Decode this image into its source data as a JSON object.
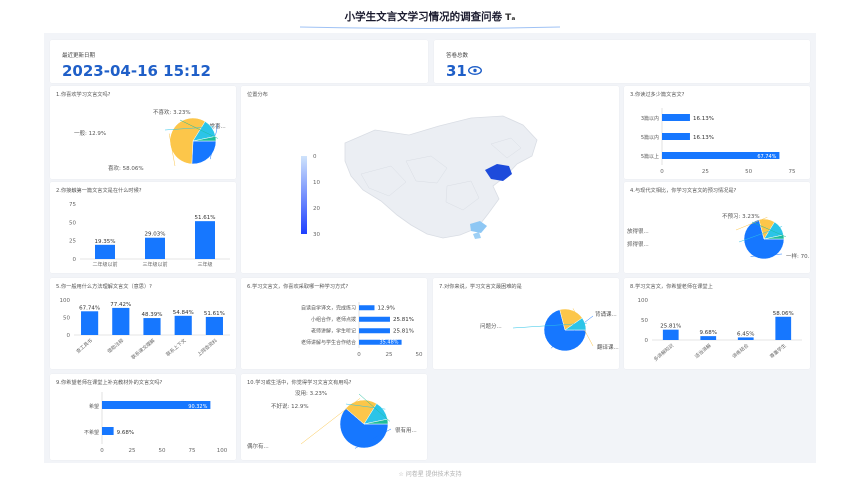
{
  "page": {
    "title": "小学生文言文学习情况的调查问卷",
    "title_icon": "Tₐ",
    "footer_icon": "☆",
    "footer": "问卷星 提供技术支持"
  },
  "stats": {
    "update_label": "最近更新日期",
    "update_value": "2023-04-16 15:12",
    "count_label": "答卷总数",
    "count_value": "31",
    "count_icon": "eye-icon"
  },
  "colors": {
    "blue": "#1677ff",
    "light_blue": "#2bc4e8",
    "yellow": "#fcc64a",
    "teal": "#1ebd9a",
    "accent": "#1f5fc8"
  },
  "chart_data": [
    {
      "id": "q1",
      "type": "pie",
      "title": "1.你喜欢学习文言文吗?",
      "labels": [
        "非常喜欢",
        "喜欢",
        "一般",
        "不喜欢"
      ],
      "display_labels": [
        "非常喜...",
        "喜欢: 58.06%",
        "一般: 12.9%",
        "不喜欢: 3.23%"
      ],
      "values": [
        25.81,
        58.06,
        12.9,
        3.23
      ],
      "colors": [
        "#1677ff",
        "#fcc64a",
        "#2bc4e8",
        "#1ebd9a"
      ]
    },
    {
      "id": "q2",
      "type": "bar",
      "title": "2.你接触第一篇文言文是在什么时候?",
      "categories": [
        "二年级以前",
        "三年级以前",
        "三年级"
      ],
      "values": [
        19.35,
        29.03,
        51.61
      ],
      "value_labels": [
        "19.35%",
        "29.03%",
        "51.61%"
      ],
      "ylim": [
        0,
        75
      ],
      "yticks": [
        0,
        25,
        50,
        75
      ]
    },
    {
      "id": "q3",
      "type": "bar",
      "orientation": "horizontal",
      "title": "3.你读过多少篇文言文?",
      "categories": [
        "3篇以内",
        "5篇以内",
        "5篇以上"
      ],
      "values": [
        16.13,
        16.13,
        67.74
      ],
      "value_labels": [
        "16.13%",
        "16.13%",
        "67.74%"
      ],
      "xlim": [
        0,
        75
      ],
      "xticks": [
        0,
        25,
        50,
        75
      ]
    },
    {
      "id": "q4",
      "type": "pie",
      "title": "4.与现代文相比，你学习文言文的预习情况是?",
      "labels": [
        "一样",
        "放得很...",
        "抓得很...",
        "不预习"
      ],
      "display_labels": [
        "一样: 70...",
        "放得很...",
        "抓得很...",
        "不预习: 3.23%"
      ],
      "values": [
        70.97,
        12.9,
        12.9,
        3.23
      ],
      "colors": [
        "#1677ff",
        "#fcc64a",
        "#2bc4e8",
        "#1ebd9a"
      ]
    },
    {
      "id": "q5",
      "type": "bar",
      "title": "5.你一般用什么方法理解文言文（意思）?",
      "categories": [
        "查工具书",
        "借助注释",
        "联系课文理解",
        "联系上下文",
        "上网查资料"
      ],
      "values": [
        67.74,
        77.42,
        48.39,
        54.84,
        51.61
      ],
      "value_labels": [
        "67.74%",
        "77.42%",
        "48.39%",
        "54.84%",
        "51.61%"
      ],
      "ylim": [
        0,
        100
      ],
      "yticks": [
        0,
        50,
        100
      ]
    },
    {
      "id": "map",
      "type": "heatmap",
      "title": "位置分布",
      "legend_ticks": [
        "0",
        "10",
        "20",
        "30"
      ],
      "vmin": 0,
      "vmax": 30
    },
    {
      "id": "q6",
      "type": "bar",
      "orientation": "horizontal",
      "title": "6.学习文言文，你喜欢采取哪一种学习方式?",
      "categories": [
        "自读自学译文，完成练习",
        "小组合作，老师点拨",
        "老师讲解，学生听记",
        "老师讲解与学生合作结合"
      ],
      "values": [
        12.9,
        25.81,
        25.81,
        35.48
      ],
      "value_labels": [
        "12.9%",
        "25.81%",
        "25.81%",
        "35.48%"
      ],
      "xlim": [
        0,
        50
      ],
      "xticks": [
        0,
        25,
        50
      ]
    },
    {
      "id": "q7",
      "type": "pie",
      "title": "7.对你来说，学习文言文最困难的是",
      "labels": [
        "背诵课...",
        "翻译课...",
        "问题分..."
      ],
      "display_labels": [
        "背诵课...",
        "翻译课...",
        "问题分..."
      ],
      "values": [
        70.97,
        19.35,
        9.68
      ],
      "colors": [
        "#1677ff",
        "#fcc64a",
        "#2bc4e8"
      ]
    },
    {
      "id": "q8",
      "type": "bar",
      "title": "8.学习文言文，你希望老师在课堂上",
      "categories": [
        "多讲解知识",
        "适当讲解",
        "讲练结合",
        "尊重学生"
      ],
      "values": [
        25.81,
        9.68,
        6.45,
        58.06
      ],
      "value_labels": [
        "25.81%",
        "9.68%",
        "6.45%",
        "58.06%"
      ],
      "ylim": [
        0,
        100
      ],
      "yticks": [
        0,
        50,
        100
      ]
    },
    {
      "id": "q9",
      "type": "bar",
      "orientation": "horizontal",
      "title": "9.你希望老师在课堂上补充教材外的文言文吗?",
      "categories": [
        "希望",
        "不希望"
      ],
      "values": [
        90.32,
        9.68
      ],
      "value_labels": [
        "90.32%",
        "9.68%"
      ],
      "xlim": [
        0,
        100
      ],
      "xticks": [
        0,
        25,
        50,
        75,
        100
      ]
    },
    {
      "id": "q10",
      "type": "pie",
      "title": "10.学习或生活中，你觉得学习文言文有用吗?",
      "labels": [
        "很有用",
        "偶尔有...",
        "不好说",
        "没用"
      ],
      "display_labels": [
        "很有用...",
        "偶尔有...",
        "不好说: 12.9%",
        "没用: 3.23%"
      ],
      "values": [
        61.29,
        22.58,
        12.9,
        3.23
      ],
      "colors": [
        "#1677ff",
        "#fcc64a",
        "#2bc4e8",
        "#1ebd9a"
      ]
    }
  ]
}
